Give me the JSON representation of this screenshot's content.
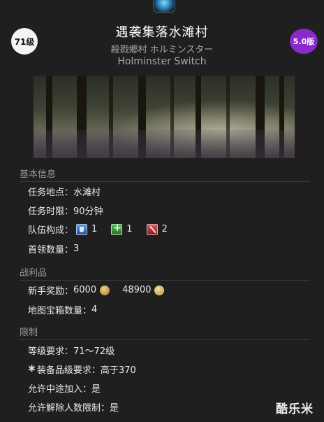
{
  "header": {
    "level_badge": "71级",
    "version_badge": "5.0版",
    "title": "遇袭集落水滩村",
    "subtitle_jp": "殺戮郷村 ホルミンスター",
    "subtitle_en": "Holminster Switch"
  },
  "sections": {
    "basic": {
      "heading": "基本信息",
      "location_label": "任务地点：",
      "location_value": "水滩村",
      "time_label": "任务时限：",
      "time_value": "90分钟",
      "party_label": "队伍构成：",
      "tank_count": "1",
      "healer_count": "1",
      "dps_count": "2",
      "boss_label": "首领数量：",
      "boss_value": "3"
    },
    "loot": {
      "heading": "战利品",
      "rookie_label": "新手奖励：",
      "gil_value": "6000",
      "seals_value": "48900",
      "treasure_label": "地图宝箱数量：",
      "treasure_value": "4"
    },
    "limits": {
      "heading": "限制",
      "level_label": "等级要求：",
      "level_value": "71～72级",
      "ilvl_label": "装备品级要求：",
      "ilvl_value": "高于370",
      "join_label": "允许中途加入：",
      "join_value": "是",
      "kick_label": "允许解除人数限制：",
      "kick_value": "是"
    }
  },
  "watermark": "酷乐米",
  "icons": {
    "tank": "shield-icon",
    "healer": "healer-cross-icon",
    "dps": "sword-icon",
    "gil": "gil-coin-icon",
    "seal": "seal-icon",
    "gear": "gear-icon"
  }
}
